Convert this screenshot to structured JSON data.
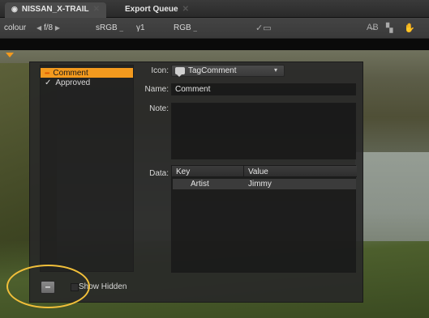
{
  "tabs": [
    {
      "label": "NISSAN_X-TRAIL",
      "icon": "eye-icon",
      "active": true
    },
    {
      "label": "Export Queue",
      "active": false
    }
  ],
  "toolbar": {
    "colour_label": "colour",
    "fstop": "f/8",
    "colorspace": "sRGB",
    "gamma": "γ1",
    "channel": "RGB"
  },
  "dialog": {
    "tags": [
      {
        "label": "Comment",
        "selected": true,
        "icon": "tag-dots-icon"
      },
      {
        "label": "Approved",
        "selected": false,
        "icon": "checkmark-icon"
      }
    ],
    "icon_label": "Icon:",
    "icon_value": "TagComment",
    "name_label": "Name:",
    "name_value": "Comment",
    "note_label": "Note:",
    "note_value": "",
    "data_label": "Data:",
    "table": {
      "columns": [
        "Key",
        "Value"
      ],
      "rows": [
        [
          "Artist",
          "Jimmy"
        ]
      ]
    },
    "remove_label": "–",
    "show_hidden_label": "Show Hidden",
    "show_hidden_checked": false
  },
  "colors": {
    "accent": "#f39a1e",
    "highlight_ring": "#f1bf3a"
  }
}
